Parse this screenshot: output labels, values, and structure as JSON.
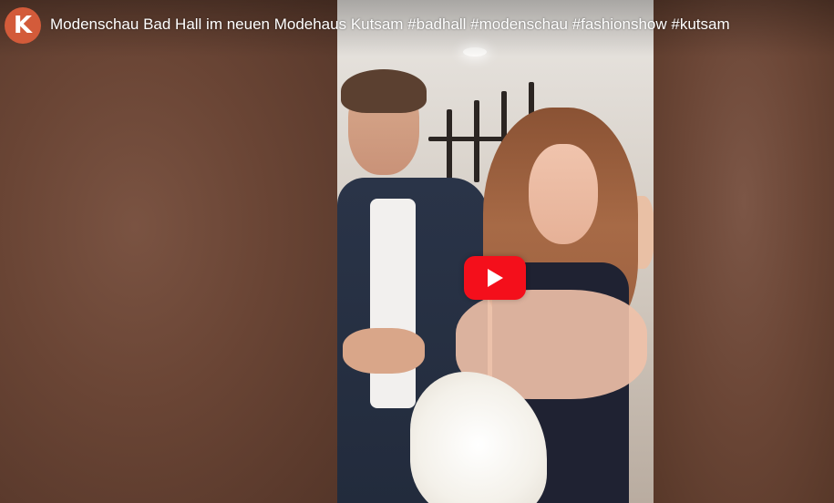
{
  "channel": {
    "avatar_letter": "K",
    "avatar_color": "#d35b3a"
  },
  "video": {
    "title": "Modenschau Bad Hall im neuen Modehaus Kutsam #badhall #modenschau #fashionshow #kutsam"
  },
  "controls": {
    "play_icon": "play-icon",
    "play_button_color": "#f40f1b"
  }
}
